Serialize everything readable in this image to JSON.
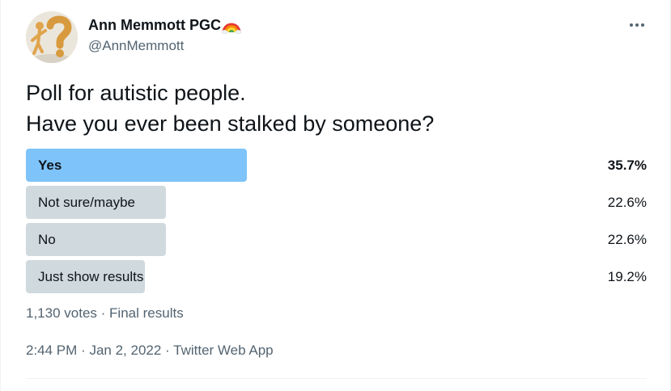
{
  "author": {
    "display_name": "Ann Memmott PGC",
    "handle": "@AnnMemmott",
    "name_emoji": "rainbow-icon",
    "avatar_icon": "question-mark-figure-icon"
  },
  "menu": {
    "more_icon": "more-horizontal-icon"
  },
  "tweet": {
    "lines": [
      "Poll for autistic people.",
      "Have you ever been stalked by someone?"
    ]
  },
  "poll": {
    "options": [
      {
        "label": "Yes",
        "percent_text": "35.7%",
        "percent": 35.7,
        "winner": true
      },
      {
        "label": "Not sure/maybe",
        "percent_text": "22.6%",
        "percent": 22.6,
        "winner": false
      },
      {
        "label": "No",
        "percent_text": "22.6%",
        "percent": 22.6,
        "winner": false
      },
      {
        "label": "Just show results",
        "percent_text": "19.2%",
        "percent": 19.2,
        "winner": false
      }
    ],
    "votes": "1,130 votes",
    "separator": "·",
    "status": "Final results"
  },
  "meta": {
    "time": "2:44 PM",
    "separator": "·",
    "date": "Jan 2, 2022",
    "source": "Twitter Web App"
  },
  "colors": {
    "winner_bar": "#7ec4fa",
    "bar": "#cfd9de",
    "text": "#0f1419",
    "secondary_text": "#536471"
  }
}
